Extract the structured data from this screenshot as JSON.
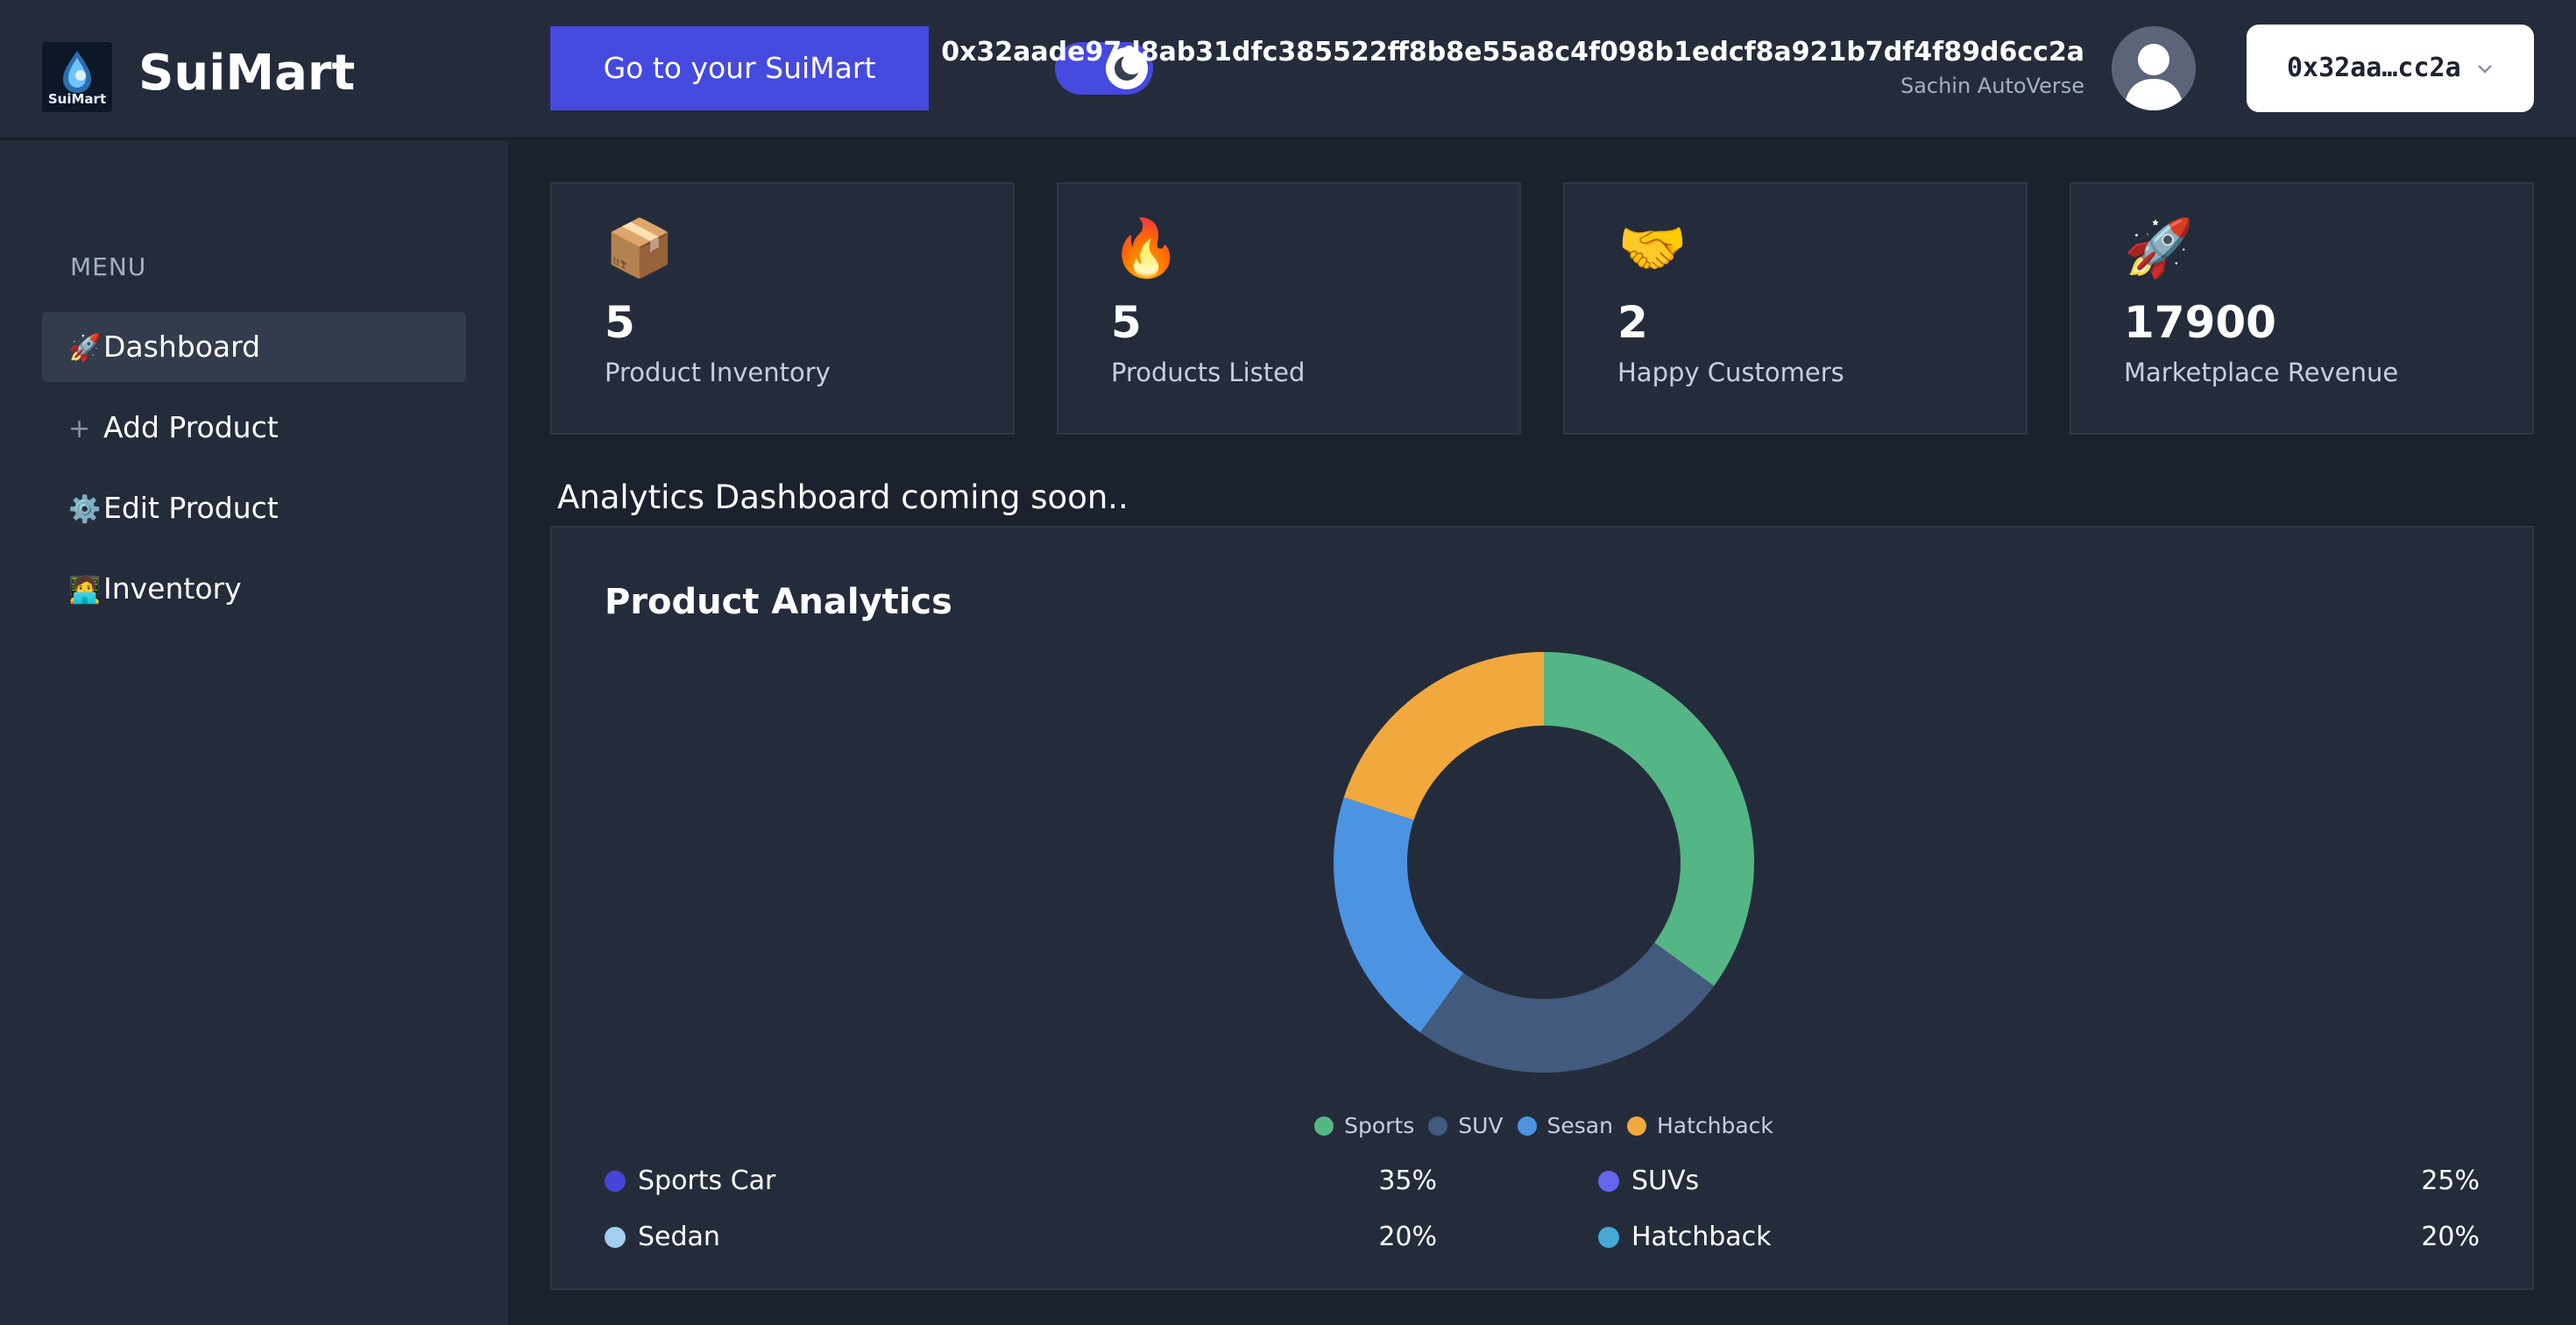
{
  "app": {
    "name": "SuiMart",
    "logo_text": "SuiMart"
  },
  "header": {
    "go_button_label": "Go to your SuiMart",
    "wallet_address": "0x32aade97d8ab31dfc385522ff8b8e55a8c4f098b1edcf8a921b7df4f89d6cc2a",
    "wallet_owner": "Sachin AutoVerse",
    "wallet_short": "0x32aa…cc2a",
    "theme_toggle_icon": "moon-icon"
  },
  "sidebar": {
    "menu_title": "MENU",
    "items": [
      {
        "icon": "🚀",
        "icon_name": "rocket-icon",
        "label": "Dashboard",
        "active": true
      },
      {
        "icon": "➕",
        "icon_name": "plus-icon",
        "label": "Add Product",
        "active": false
      },
      {
        "icon": "⚙️",
        "icon_name": "gear-icon",
        "label": "Edit Product",
        "active": false
      },
      {
        "icon": "🧑‍💻",
        "icon_name": "technologist-icon",
        "label": "Inventory",
        "active": false
      }
    ]
  },
  "stats": [
    {
      "icon": "📦",
      "icon_name": "package-icon",
      "value": "5",
      "label": "Product Inventory"
    },
    {
      "icon": "🔥",
      "icon_name": "fire-icon",
      "value": "5",
      "label": "Products Listed"
    },
    {
      "icon": "🤝",
      "icon_name": "handshake-icon",
      "value": "2",
      "label": "Happy Customers"
    },
    {
      "icon": "🚀",
      "icon_name": "rocket-icon",
      "value": "17900",
      "label": "Marketplace Revenue"
    }
  ],
  "coming_soon": "Analytics Dashboard coming soon..",
  "analytics": {
    "title": "Product Analytics",
    "breakdown": [
      {
        "name": "Sports Car",
        "percent": "35%",
        "color": "#4546d9"
      },
      {
        "name": "SUVs",
        "percent": "25%",
        "color": "#6266ea"
      },
      {
        "name": "Sedan",
        "percent": "20%",
        "color": "#a3cfef"
      },
      {
        "name": "Hatchback",
        "percent": "20%",
        "color": "#45a9d6"
      }
    ]
  },
  "chart_data": {
    "type": "pie",
    "title": "",
    "categories": [
      "Sports",
      "SUV",
      "Sesan",
      "Hatchback"
    ],
    "values": [
      35,
      25,
      20,
      20
    ],
    "colors": [
      "#54b585",
      "#425a7e",
      "#4c94e2",
      "#f1a93e"
    ],
    "donut": true,
    "legend": "bottom"
  }
}
